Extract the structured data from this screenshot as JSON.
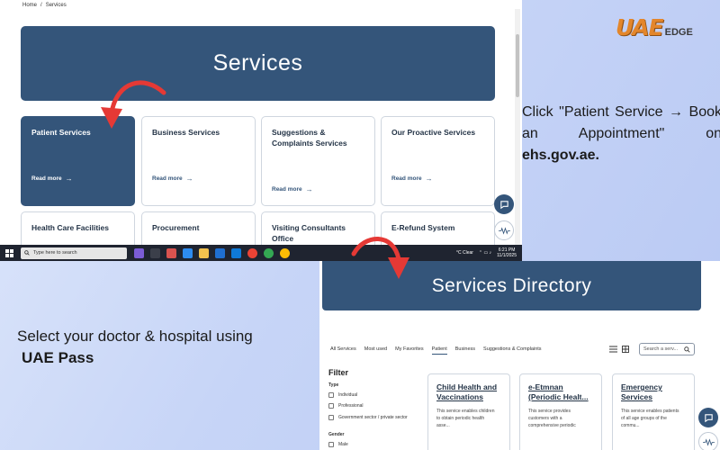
{
  "brand": {
    "main": "UAE",
    "sub": "EDGE"
  },
  "top_screenshot": {
    "breadcrumb": [
      "Home",
      "/",
      "Services"
    ],
    "banner_title": "Services",
    "cards": [
      {
        "title": "Patient Services",
        "more": "Read more",
        "active": true
      },
      {
        "title": "Business Services",
        "more": "Read more"
      },
      {
        "title": "Suggestions & Complaints Services",
        "more": "Read more"
      },
      {
        "title": "Our Proactive Services",
        "more": "Read more"
      },
      {
        "title": "Health Care Facilities"
      },
      {
        "title": "Procurement"
      },
      {
        "title": "Visiting Consultants Office"
      },
      {
        "title": "E-Refund System"
      }
    ],
    "taskbar": {
      "search_placeholder": "Type here to search",
      "weather": "°C  Clear",
      "time": "6:21 PM",
      "date": "11/1/2025"
    }
  },
  "caption_top": {
    "text": "Click \"Patient Service → Book an Appointment\" on",
    "domain": "ehs.gov.ae."
  },
  "caption_bottom": {
    "line1": "Select your doctor & hospital using",
    "line2": "UAE Pass"
  },
  "bottom_screenshot": {
    "banner_title": "Services Directory",
    "tabs": [
      "All Services",
      "Most used",
      "My Favorites",
      "Patient",
      "Business",
      "Suggestions & Complaints"
    ],
    "active_tab": "Patient",
    "search_placeholder": "Search a serv...",
    "filter": {
      "title": "Filter",
      "type_label": "Type",
      "type_options": [
        "Individual",
        "Professional",
        "Government sector / private sector"
      ],
      "gender_label": "Gender",
      "gender_options": [
        "Male"
      ]
    },
    "cards": [
      {
        "title_lines": [
          "Child Health and",
          "Vaccinations"
        ],
        "desc": [
          "This service enables children",
          "to obtain periodic health",
          "asse..."
        ]
      },
      {
        "title_lines": [
          "e-Etmnan",
          "(Periodic Healt..."
        ],
        "desc": [
          "This service provides",
          "customers with a",
          "comprehensive periodic"
        ]
      },
      {
        "title_lines": [
          "Emergency",
          "Services"
        ],
        "desc": [
          "This service enables patients",
          "of all age groups of the",
          "commu..."
        ]
      }
    ]
  },
  "colors": {
    "primary": "#34557a",
    "arrow": "#e53935",
    "brand_orange": "#e3862b"
  },
  "icons": [
    "search-icon",
    "chat-icon",
    "voice-wave-icon",
    "arrow-right-icon",
    "list-view-icon",
    "grid-view-icon",
    "windows-logo-icon"
  ]
}
